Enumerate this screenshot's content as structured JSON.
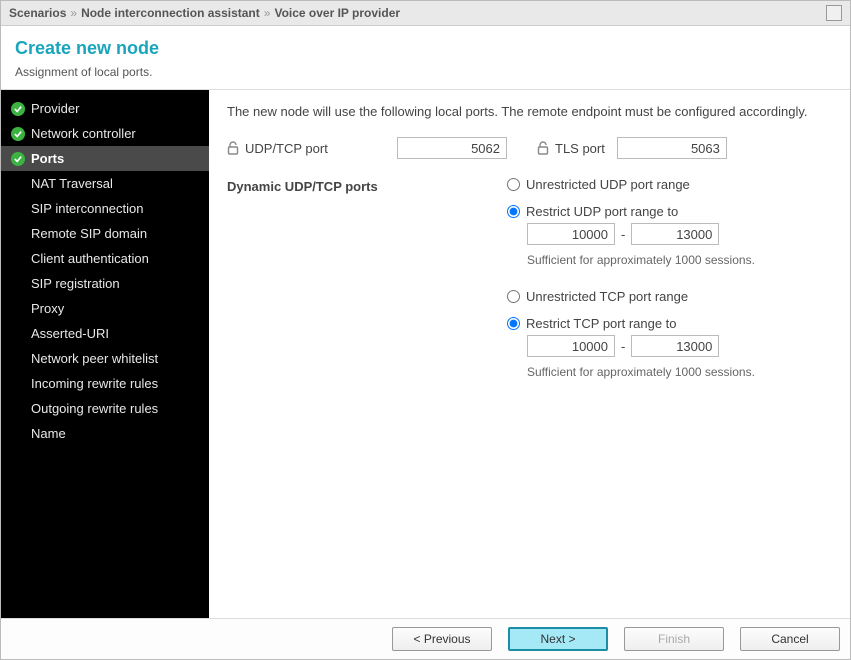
{
  "breadcrumb": {
    "items": [
      "Scenarios",
      "Node interconnection assistant",
      "Voice over IP provider"
    ],
    "separator": "»"
  },
  "header": {
    "title": "Create new node",
    "subtitle": "Assignment of local ports."
  },
  "sidebar": {
    "steps": [
      {
        "label": "Provider",
        "completed": true,
        "active": false
      },
      {
        "label": "Network controller",
        "completed": true,
        "active": false
      },
      {
        "label": "Ports",
        "completed": true,
        "active": true
      },
      {
        "label": "NAT Traversal",
        "completed": false,
        "active": false,
        "indented": true
      },
      {
        "label": "SIP interconnection",
        "completed": false,
        "active": false,
        "indented": true
      },
      {
        "label": "Remote SIP domain",
        "completed": false,
        "active": false,
        "indented": true
      },
      {
        "label": "Client authentication",
        "completed": false,
        "active": false,
        "indented": true
      },
      {
        "label": "SIP registration",
        "completed": false,
        "active": false,
        "indented": true
      },
      {
        "label": "Proxy",
        "completed": false,
        "active": false,
        "indented": true
      },
      {
        "label": "Asserted-URI",
        "completed": false,
        "active": false,
        "indented": true
      },
      {
        "label": "Network peer whitelist",
        "completed": false,
        "active": false,
        "indented": true
      },
      {
        "label": "Incoming rewrite rules",
        "completed": false,
        "active": false,
        "indented": true
      },
      {
        "label": "Outgoing rewrite rules",
        "completed": false,
        "active": false,
        "indented": true
      },
      {
        "label": "Name",
        "completed": false,
        "active": false,
        "indented": true
      }
    ]
  },
  "main": {
    "intro": "The new node will use the following local ports. The remote endpoint must be configured accordingly.",
    "udp_tcp_port": {
      "label": "UDP/TCP port",
      "value": "5062"
    },
    "tls_port": {
      "label": "TLS port",
      "value": "5063"
    },
    "dynamic_label": "Dynamic UDP/TCP ports",
    "udp_group": {
      "unrestricted_label": "Unrestricted UDP port range",
      "restrict_label": "Restrict UDP port range to",
      "selected": "restrict",
      "from": "10000",
      "to": "13000",
      "separator": "-",
      "hint": "Sufficient for approximately 1000 sessions."
    },
    "tcp_group": {
      "unrestricted_label": "Unrestricted TCP port range",
      "restrict_label": "Restrict TCP port range to",
      "selected": "restrict",
      "from": "10000",
      "to": "13000",
      "separator": "-",
      "hint": "Sufficient for approximately 1000 sessions."
    }
  },
  "footer": {
    "previous": "< Previous",
    "next": "Next >",
    "finish": "Finish",
    "cancel": "Cancel"
  }
}
